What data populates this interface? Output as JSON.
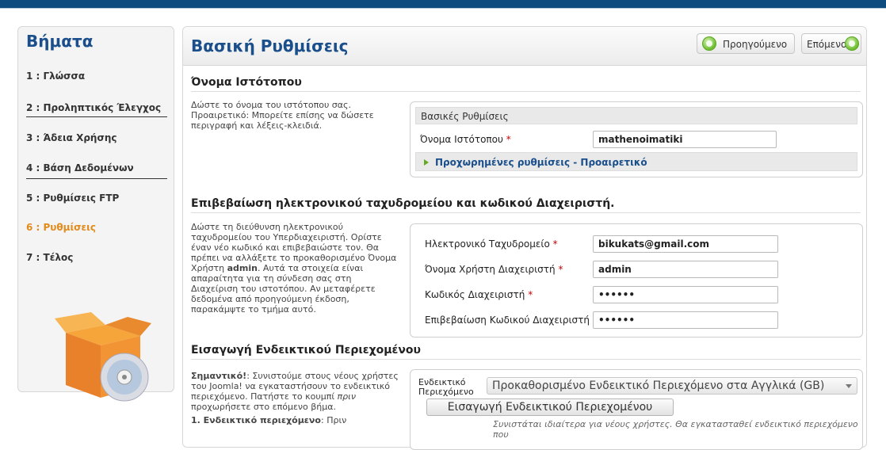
{
  "steps": {
    "title": "Βήματα",
    "items": [
      {
        "label": "1 : Γλώσσα"
      },
      {
        "label": "2 : Προληπτικός Έλεγχος"
      },
      {
        "label": "3 : Άδεια Χρήσης"
      },
      {
        "label": "4 : Βάση Δεδομένων"
      },
      {
        "label": "5 : Ρυθμίσεις FTP"
      },
      {
        "label": "6 : Ρυθμίσεις"
      },
      {
        "label": "7 : Τέλος"
      }
    ],
    "active_index": 5
  },
  "header": {
    "title": "Βασική Ρυθμίσεις",
    "prev_label": "Προηγούμενο",
    "next_label": "Επόμενο"
  },
  "site": {
    "section_title": "Όνομα Ιστότοπου",
    "description": "Δώστε το όνομα του ιστότοπου σας. Προαιρετικό: Μπορείτε επίσης να δώσετε περιγραφή και λέξεις-κλειδιά.",
    "panel_title": "Βασικές Ρυθμίσεις",
    "name_label": "Όνομα Ιστότοπου",
    "name_value": "mathenoimatiki",
    "advanced_label": "Προχωρημένες ρυθμίσεις - Προαιρετικό"
  },
  "admin": {
    "section_title": "Επιβεβαίωση ηλεκτρονικού ταχυδρομείου και κωδικού Διαχειριστή.",
    "description_pre": "Δώστε τη διεύθυνση ηλεκτρονικού ταχυδρομείου του Υπερδιαχειριστή. Ορίστε έναν νέο κωδικό και επιβεβαιώστε τον. Θα πρέπει να αλλάξετε το προκαθορισμένο Όνομα Χρήστη ",
    "description_bold": "admin",
    "description_post": ". Αυτά τα στοιχεία είναι απαραίτητα για τη σύνδεση σας στη Διαχείριση του ιστοτόπου. Αν μεταφέρετε δεδομένα από προηγούμενη έκδοση, παρακάμψτε το τμήμα αυτό.",
    "fields": [
      {
        "label": "Ηλεκτρονικό Ταχυδρομείο",
        "value": "bikukats@gmail.com"
      },
      {
        "label": "Όνομα Χρήστη Διαχειριστή",
        "value": "admin"
      },
      {
        "label": "Κωδικός Διαχειριστή",
        "value": "••••••"
      },
      {
        "label": "Επιβεβαίωση Κωδικού Διαχειριστή",
        "value": "••••••"
      }
    ]
  },
  "sample": {
    "section_title": "Εισαγωγή Ενδεικτικού Περιεχομένου",
    "important_label": "Σημαντικό!",
    "desc_a": ": Συνιστούμε στους νέους χρήστες του Joomla! να εγκαταστήσουν το ενδεικτικό περιεχόμενο. Πατήστε το κουμπί ",
    "desc_em": "πριν",
    "desc_b": " προχωρήσετε στο επόμενο βήμα.",
    "sub_bold": "1. Ενδεικτικό περιεχόμενο",
    "sub_text": ": Πριν",
    "select_label_1": "Ενδεικτικό",
    "select_label_2": "Περιεχόμενο",
    "select_value": "Προκαθορισμένο Ενδεικτικό Περιεχόμενο στα Αγγλικά (GB)",
    "install_button": "Εισαγωγή Ενδεικτικού Περιεχομένου",
    "note": "Συνιστάται ιδιαίτερα για νέους χρήστες. Θα εγκατασταθεί ενδεικτικό περιεχόμενο που"
  },
  "colors": {
    "accent": "#1a4f8b",
    "active_step": "#e28a1a",
    "required": "#cc0000",
    "topbar": "#0e4b7f"
  }
}
